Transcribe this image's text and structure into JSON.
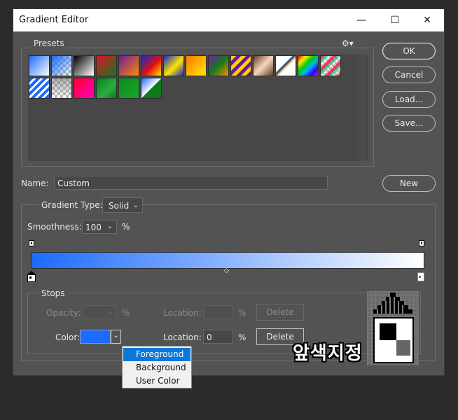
{
  "window": {
    "title": "Gradient Editor",
    "controls": {
      "minimize": "—",
      "maximize": "☐",
      "close": "✕"
    }
  },
  "presets": {
    "label": "Presets",
    "gear": "⚙▾"
  },
  "buttons": {
    "ok": "OK",
    "cancel": "Cancel",
    "load": "Load...",
    "save": "Save...",
    "new": "New"
  },
  "name": {
    "label": "Name:",
    "value": "Custom"
  },
  "gradient_type": {
    "label": "Gradient Type:",
    "value": "Solid"
  },
  "smoothness": {
    "label": "Smoothness:",
    "value": "100",
    "unit": "%"
  },
  "stops": {
    "label": "Stops",
    "opacity_label": "Opacity:",
    "opacity_unit": "%",
    "opacity_location_label": "Location:",
    "opacity_location_unit": "%",
    "opacity_delete": "Delete",
    "color_label": "Color:",
    "color_location_label": "Location:",
    "color_location_value": "0",
    "color_location_unit": "%",
    "color_delete": "Delete"
  },
  "color_menu": {
    "items": [
      "Foreground",
      "Background",
      "User Color"
    ],
    "selected": "Foreground"
  },
  "overlay_caption": "앞색지정",
  "colors": {
    "gradient_start": "#1c6bff",
    "gradient_end": "#ffffff",
    "stop_color": "#1c6bff",
    "menu_highlight": "#0a78d7"
  }
}
